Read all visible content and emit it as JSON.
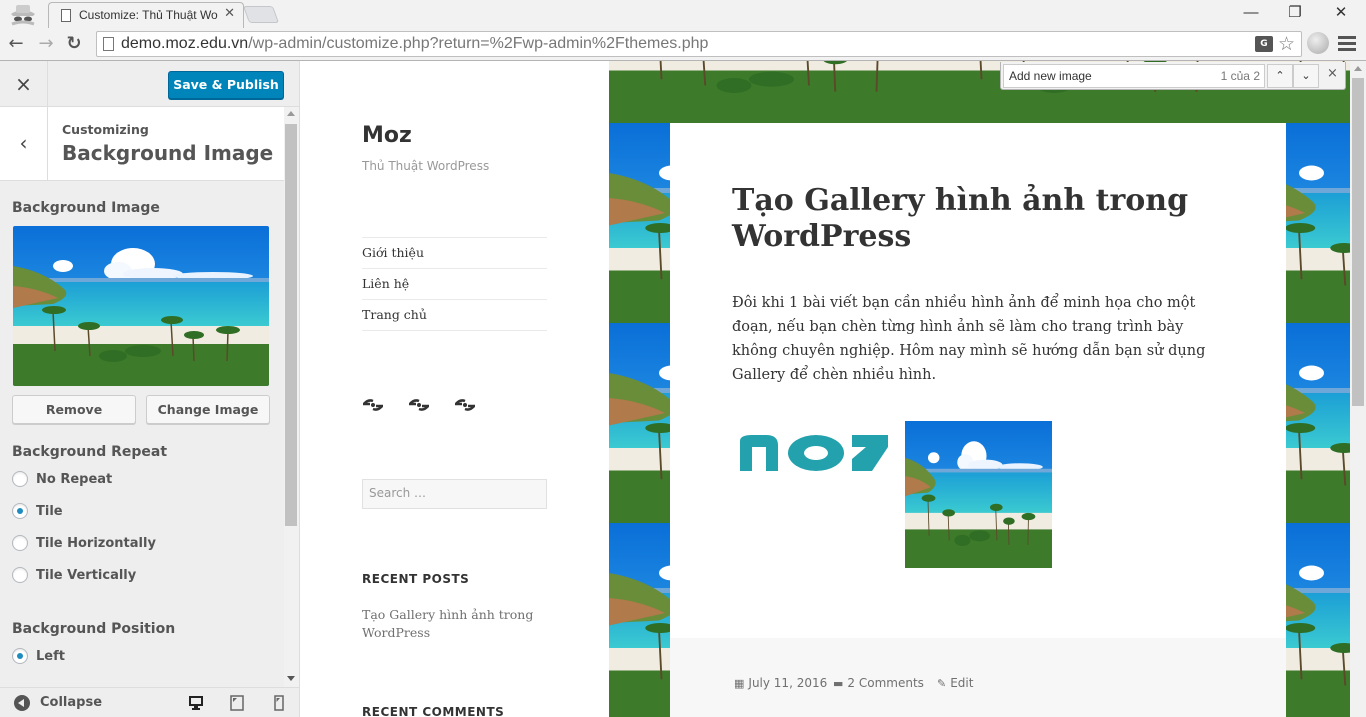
{
  "browser": {
    "tab_title": "Customize: Thủ Thuật Wo",
    "url_host": "demo.moz.edu.vn",
    "url_path": "/wp-admin/customize.php?return=%2Fwp-admin%2Fthemes.php",
    "window_controls": {
      "minimize": "—",
      "restore": "❐",
      "close": "✕"
    }
  },
  "find_bar": {
    "query": "Add new image",
    "count": "1 của 2",
    "prev": "⌃",
    "next": "⌄",
    "close": "×"
  },
  "customizer": {
    "close_label": "×",
    "save_publish": "Save & Publish",
    "back_label": "‹",
    "customizing": "Customizing",
    "section_title": "Background Image",
    "bg_image_label": "Background Image",
    "remove_button": "Remove",
    "change_image_button": "Change Image",
    "bg_repeat": {
      "title": "Background Repeat",
      "options": [
        {
          "label": "No Repeat",
          "checked": false
        },
        {
          "label": "Tile",
          "checked": true
        },
        {
          "label": "Tile Horizontally",
          "checked": false
        },
        {
          "label": "Tile Vertically",
          "checked": false
        }
      ]
    },
    "bg_position": {
      "title": "Background Position",
      "options": [
        {
          "label": "Left",
          "checked": true
        }
      ]
    },
    "footer": {
      "collapse": "Collapse",
      "devices": [
        "desktop",
        "tablet",
        "mobile"
      ]
    },
    "accent_color": "#0085ba"
  },
  "site": {
    "title": "Moz",
    "description": "Thủ Thuật WordPress",
    "menu": [
      "Giới thiệu",
      "Liên hệ",
      "Trang chủ"
    ],
    "search_placeholder": "Search …",
    "recent_posts_title": "RECENT POSTS",
    "recent_posts": [
      "Tạo Gallery hình ảnh trong WordPress"
    ],
    "recent_comments_title": "RECENT COMMENTS"
  },
  "post": {
    "title": "Tạo Gallery hình ảnh trong WordPress",
    "body": "Đôi khi 1 bài viết bạn cần nhiều hình ảnh để minh họa cho một đoạn, nếu bạn chèn từng hình ảnh sẽ làm cho trang trình bày không chuyên nghiệp. Hôm nay mình sẽ hướng dẫn bạn sử dụng Gallery để chèn nhiều hình.",
    "logo_text": "moz",
    "date": "July 11, 2016",
    "comments": "2 Comments",
    "edit": "Edit"
  }
}
